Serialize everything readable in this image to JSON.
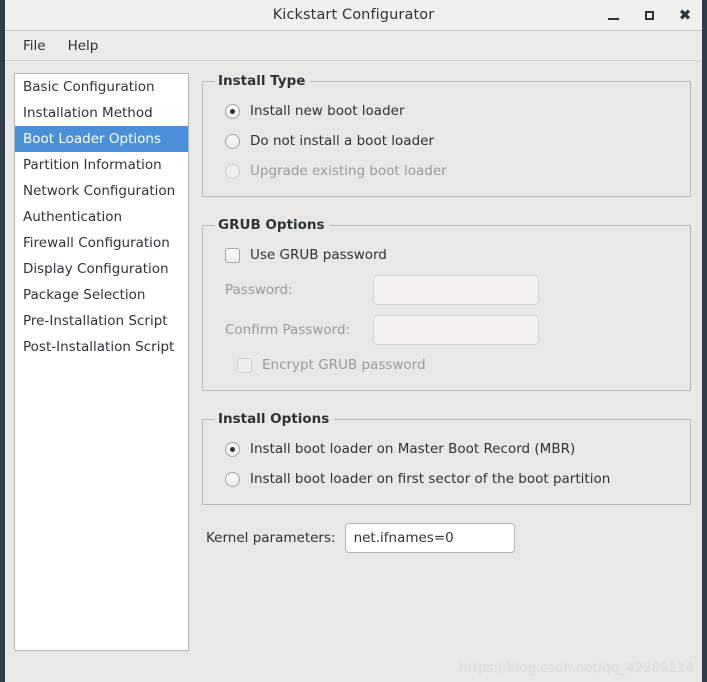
{
  "window": {
    "title": "Kickstart Configurator",
    "controls": {
      "minimize": "minimize-icon",
      "maximize": "maximize-icon",
      "close": "close-icon"
    }
  },
  "menubar": {
    "items": [
      {
        "label": "File"
      },
      {
        "label": "Help"
      }
    ]
  },
  "sidebar": {
    "selected_index": 2,
    "items": [
      {
        "label": "Basic Configuration"
      },
      {
        "label": "Installation Method"
      },
      {
        "label": "Boot Loader Options"
      },
      {
        "label": "Partition Information"
      },
      {
        "label": "Network Configuration"
      },
      {
        "label": "Authentication"
      },
      {
        "label": "Firewall Configuration"
      },
      {
        "label": "Display Configuration"
      },
      {
        "label": "Package Selection"
      },
      {
        "label": "Pre-Installation Script"
      },
      {
        "label": "Post-Installation Script"
      }
    ]
  },
  "install_type": {
    "legend": "Install Type",
    "options": [
      {
        "label": "Install new boot loader",
        "checked": true,
        "disabled": false
      },
      {
        "label": "Do not install a boot loader",
        "checked": false,
        "disabled": false
      },
      {
        "label": "Upgrade existing boot loader",
        "checked": false,
        "disabled": true
      }
    ]
  },
  "grub_options": {
    "legend": "GRUB Options",
    "use_password": {
      "label": "Use GRUB password",
      "checked": false,
      "disabled": false
    },
    "password": {
      "label": "Password:",
      "value": "",
      "disabled": true
    },
    "confirm_password": {
      "label": "Confirm Password:",
      "value": "",
      "disabled": true
    },
    "encrypt": {
      "label": "Encrypt GRUB password",
      "checked": false,
      "disabled": true
    }
  },
  "install_options": {
    "legend": "Install Options",
    "options": [
      {
        "label": "Install boot loader on Master Boot Record (MBR)",
        "checked": true,
        "disabled": false
      },
      {
        "label": "Install boot loader on first sector of the boot partition",
        "checked": false,
        "disabled": false
      }
    ]
  },
  "kernel_parameters": {
    "label": "Kernel parameters:",
    "value": "net.ifnames=0"
  },
  "watermark": {
    "text": "https://blog.csdn.net/qq_42289214"
  },
  "colors": {
    "selection": "#4a90d9",
    "window_bg": "#e8e8e6",
    "border_dark": "#2e3d49",
    "text": "#2e3436",
    "text_disabled": "#9a9a96"
  }
}
